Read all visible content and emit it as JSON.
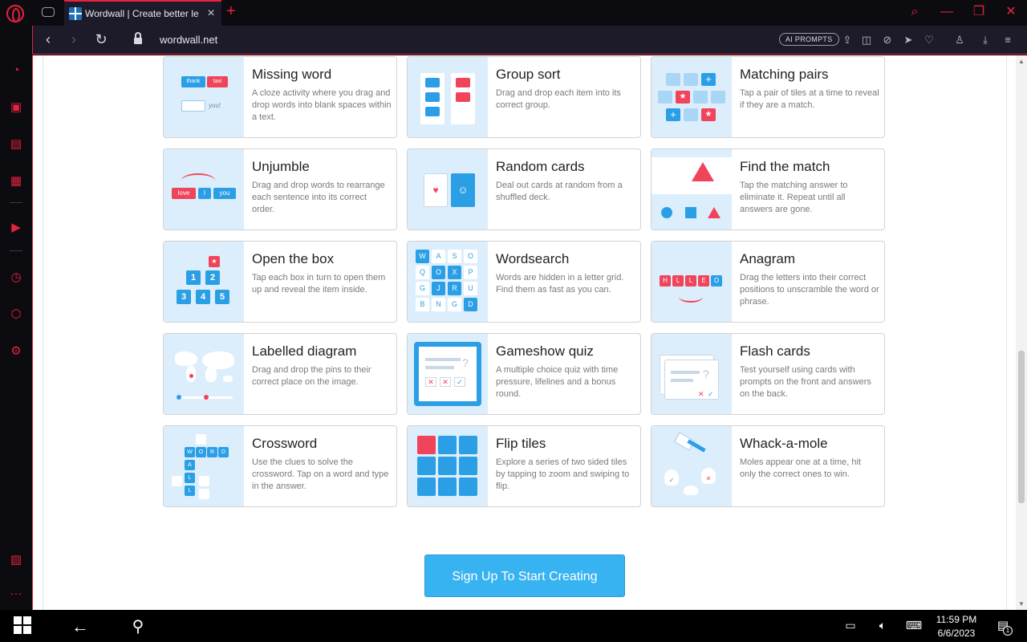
{
  "browser": {
    "tab_title": "Wordwall | Create better le",
    "url": "wordwall.net",
    "ai_prompts_label": "AI PROMPTS"
  },
  "templates": [
    {
      "title": "Missing word",
      "desc": "A cloze activity where you drag and drop words into blank spaces within a text.",
      "thumb_words": [
        "thank",
        "taxi",
        "you!"
      ]
    },
    {
      "title": "Group sort",
      "desc": "Drag and drop each item into its correct group."
    },
    {
      "title": "Matching pairs",
      "desc": "Tap a pair of tiles at a time to reveal if they are a match."
    },
    {
      "title": "Unjumble",
      "desc": "Drag and drop words to rearrange each sentence into its correct order.",
      "thumb_words": [
        "love",
        "I",
        "you"
      ]
    },
    {
      "title": "Random cards",
      "desc": "Deal out cards at random from a shuffled deck."
    },
    {
      "title": "Find the match",
      "desc": "Tap the matching answer to eliminate it. Repeat until all answers are gone."
    },
    {
      "title": "Open the box",
      "desc": "Tap each box in turn to open them up and reveal the item inside.",
      "thumb_numbers": [
        "1",
        "2",
        "3",
        "4",
        "5"
      ]
    },
    {
      "title": "Wordsearch",
      "desc": "Words are hidden in a letter grid. Find them as fast as you can.",
      "thumb_letters": [
        "W",
        "A",
        "S",
        "O",
        "Q",
        "O",
        "X",
        "P",
        "G",
        "J",
        "R",
        "U",
        "B",
        "N",
        "G",
        "D"
      ]
    },
    {
      "title": "Anagram",
      "desc": "Drag the letters into their correct positions to unscramble the word or phrase.",
      "thumb_letters": [
        "H",
        "L",
        "L",
        "E",
        "O"
      ]
    },
    {
      "title": "Labelled diagram",
      "desc": "Drag and drop the pins to their correct place on the image."
    },
    {
      "title": "Gameshow quiz",
      "desc": "A multiple choice quiz with time pressure, lifelines and a bonus round."
    },
    {
      "title": "Flash cards",
      "desc": "Test yourself using cards with prompts on the front and answers on the back."
    },
    {
      "title": "Crossword",
      "desc": "Use the clues to solve the crossword. Tap on a word and type in the answer.",
      "thumb_letters": [
        "W",
        "O",
        "R",
        "D",
        "A",
        "L",
        "L"
      ]
    },
    {
      "title": "Flip tiles",
      "desc": "Explore a series of two sided tiles by tapping to zoom and swiping to flip."
    },
    {
      "title": "Whack-a-mole",
      "desc": "Moles appear one at a time, hit only the correct ones to win."
    }
  ],
  "signup_button": "Sign Up To Start Creating",
  "taskbar": {
    "time": "11:59 PM",
    "date": "6/6/2023",
    "notification_count": "1"
  }
}
